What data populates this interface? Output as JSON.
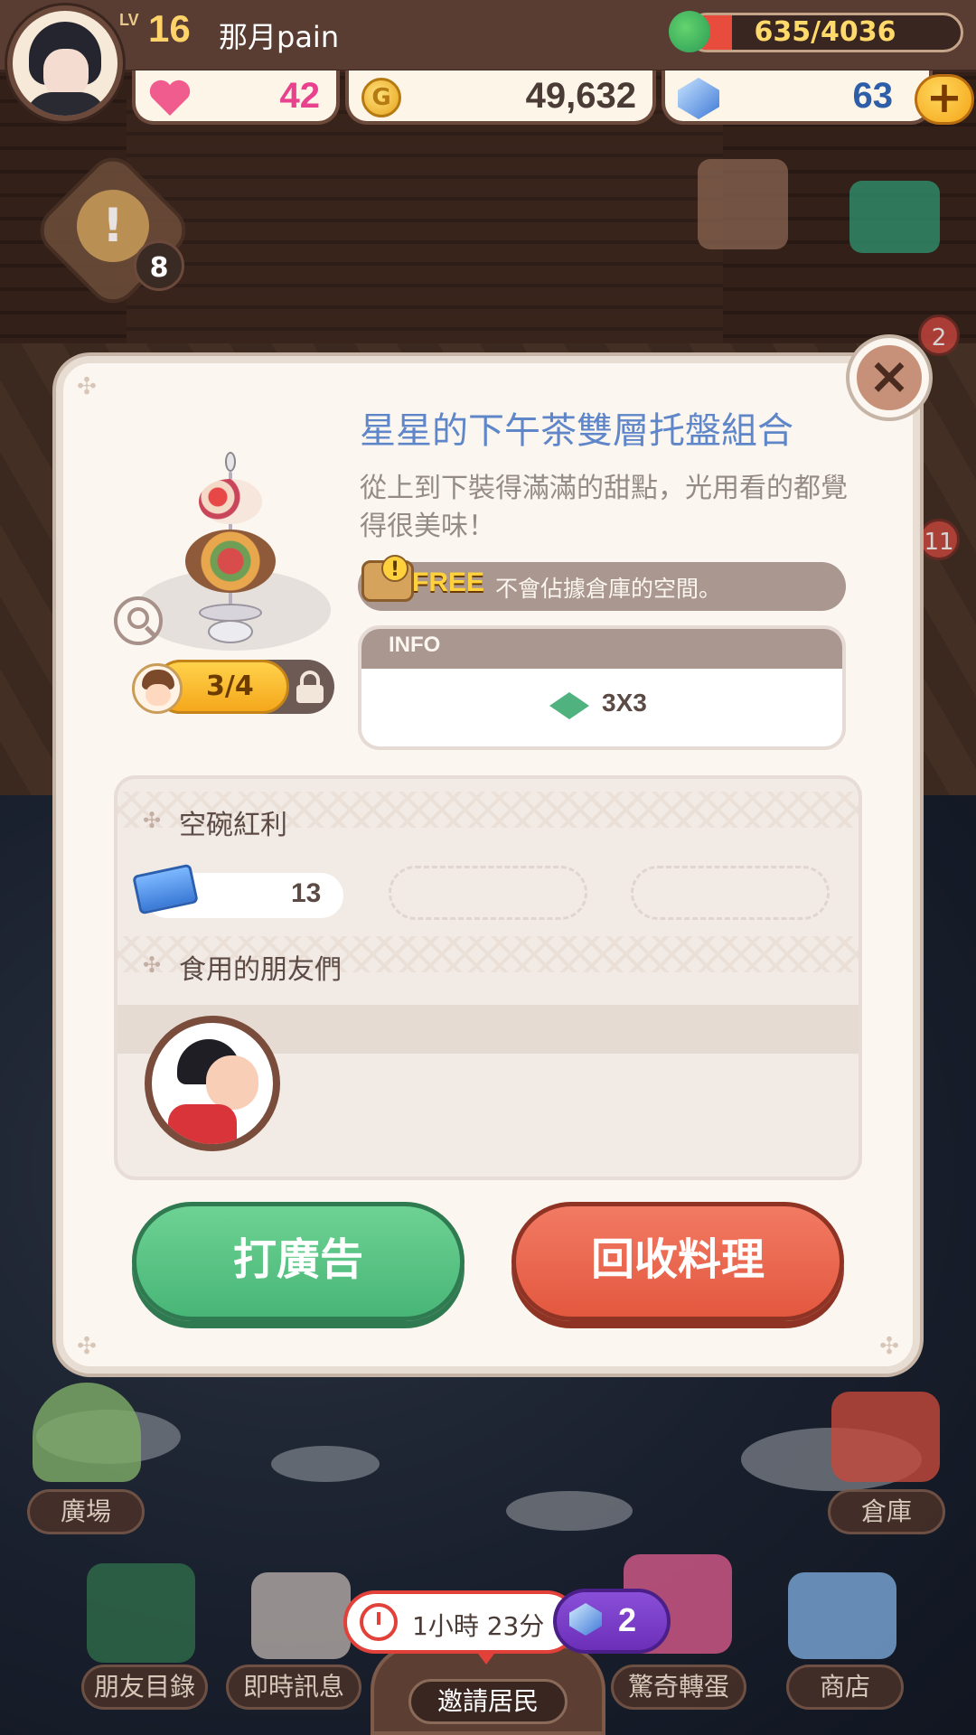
{
  "user": {
    "level_prefix": "LV",
    "level": "16",
    "name": "那月pain"
  },
  "hud": {
    "exp_text": "635/4036",
    "exp_fraction": 0.157,
    "hearts": "42",
    "coins": "49,632",
    "gems": "63",
    "plus_label": "+",
    "quest_count": "8",
    "side_badges": [
      "2",
      "11"
    ]
  },
  "modal": {
    "close_label": "×",
    "title": "星星的下午茶雙層托盤組合",
    "description": "從上到下裝得滿滿的甜點，光用看的都覺得很美味！",
    "free_label": "FREE",
    "free_text": "不會佔據倉庫的空間。",
    "info_label": "INFO",
    "size": "3X3",
    "eat_progress": "3/4",
    "section_bonus": "空碗紅利",
    "bonus_value": "13",
    "section_friends": "食用的朋友們",
    "btn_ad": "打廣告",
    "btn_recycle": "回收料理"
  },
  "bottom": {
    "plaza": "廣場",
    "warehouse": "倉庫",
    "friends": "朋友目錄",
    "messages": "即時訊息",
    "invite": "邀請居民",
    "gacha": "驚奇轉蛋",
    "shop": "商店",
    "timer": "1小時 23分",
    "gem_cost": "2"
  },
  "colors": {
    "title_blue": "#5f86c9",
    "ad_green": "#48b677",
    "recycle_red": "#e3583f",
    "gold": "#f5a71b"
  }
}
